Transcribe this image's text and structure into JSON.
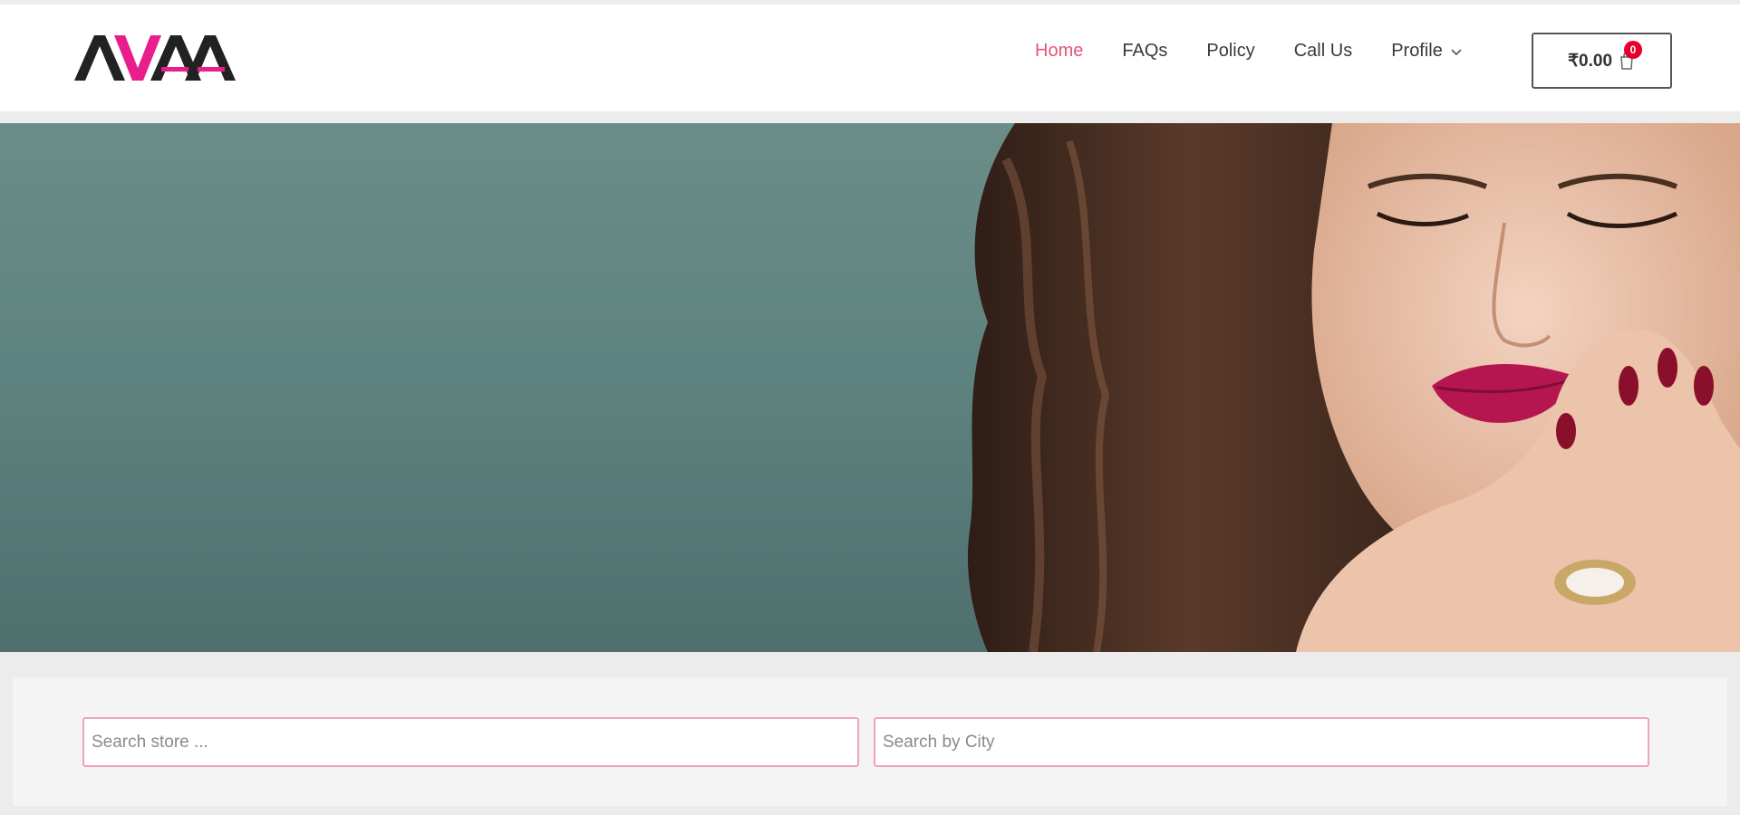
{
  "brand": {
    "logo_text": "AVAA",
    "accent": "#e91e8c"
  },
  "nav": {
    "items": [
      {
        "label": "Home",
        "active": true
      },
      {
        "label": "FAQs",
        "active": false
      },
      {
        "label": "Policy",
        "active": false
      },
      {
        "label": "Call Us",
        "active": false
      },
      {
        "label": "Profile",
        "active": false,
        "has_dropdown": true
      }
    ],
    "active_color": "#e6557a"
  },
  "cart": {
    "amount": "₹0.00",
    "count": "0",
    "icon": "cart-icon",
    "badge_color": "#e4002b"
  },
  "search": {
    "store_placeholder": "Search store ...",
    "city_placeholder": "Search by City",
    "border_color": "#f0a3b4"
  }
}
